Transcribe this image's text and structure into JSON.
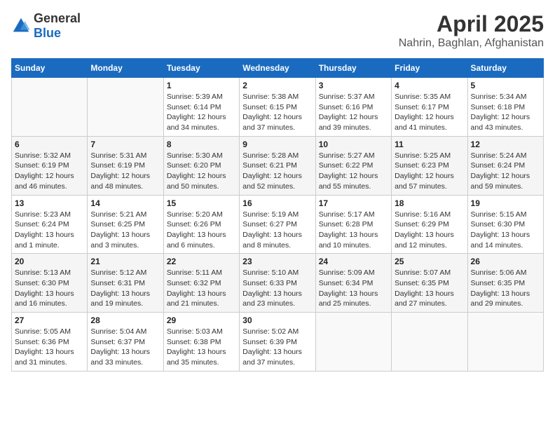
{
  "logo": {
    "general": "General",
    "blue": "Blue"
  },
  "title": "April 2025",
  "location": "Nahrin, Baghlan, Afghanistan",
  "weekdays": [
    "Sunday",
    "Monday",
    "Tuesday",
    "Wednesday",
    "Thursday",
    "Friday",
    "Saturday"
  ],
  "weeks": [
    [
      {
        "day": "",
        "sunrise": "",
        "sunset": "",
        "daylight": ""
      },
      {
        "day": "",
        "sunrise": "",
        "sunset": "",
        "daylight": ""
      },
      {
        "day": "1",
        "sunrise": "Sunrise: 5:39 AM",
        "sunset": "Sunset: 6:14 PM",
        "daylight": "Daylight: 12 hours and 34 minutes."
      },
      {
        "day": "2",
        "sunrise": "Sunrise: 5:38 AM",
        "sunset": "Sunset: 6:15 PM",
        "daylight": "Daylight: 12 hours and 37 minutes."
      },
      {
        "day": "3",
        "sunrise": "Sunrise: 5:37 AM",
        "sunset": "Sunset: 6:16 PM",
        "daylight": "Daylight: 12 hours and 39 minutes."
      },
      {
        "day": "4",
        "sunrise": "Sunrise: 5:35 AM",
        "sunset": "Sunset: 6:17 PM",
        "daylight": "Daylight: 12 hours and 41 minutes."
      },
      {
        "day": "5",
        "sunrise": "Sunrise: 5:34 AM",
        "sunset": "Sunset: 6:18 PM",
        "daylight": "Daylight: 12 hours and 43 minutes."
      }
    ],
    [
      {
        "day": "6",
        "sunrise": "Sunrise: 5:32 AM",
        "sunset": "Sunset: 6:19 PM",
        "daylight": "Daylight: 12 hours and 46 minutes."
      },
      {
        "day": "7",
        "sunrise": "Sunrise: 5:31 AM",
        "sunset": "Sunset: 6:19 PM",
        "daylight": "Daylight: 12 hours and 48 minutes."
      },
      {
        "day": "8",
        "sunrise": "Sunrise: 5:30 AM",
        "sunset": "Sunset: 6:20 PM",
        "daylight": "Daylight: 12 hours and 50 minutes."
      },
      {
        "day": "9",
        "sunrise": "Sunrise: 5:28 AM",
        "sunset": "Sunset: 6:21 PM",
        "daylight": "Daylight: 12 hours and 52 minutes."
      },
      {
        "day": "10",
        "sunrise": "Sunrise: 5:27 AM",
        "sunset": "Sunset: 6:22 PM",
        "daylight": "Daylight: 12 hours and 55 minutes."
      },
      {
        "day": "11",
        "sunrise": "Sunrise: 5:25 AM",
        "sunset": "Sunset: 6:23 PM",
        "daylight": "Daylight: 12 hours and 57 minutes."
      },
      {
        "day": "12",
        "sunrise": "Sunrise: 5:24 AM",
        "sunset": "Sunset: 6:24 PM",
        "daylight": "Daylight: 12 hours and 59 minutes."
      }
    ],
    [
      {
        "day": "13",
        "sunrise": "Sunrise: 5:23 AM",
        "sunset": "Sunset: 6:24 PM",
        "daylight": "Daylight: 13 hours and 1 minute."
      },
      {
        "day": "14",
        "sunrise": "Sunrise: 5:21 AM",
        "sunset": "Sunset: 6:25 PM",
        "daylight": "Daylight: 13 hours and 3 minutes."
      },
      {
        "day": "15",
        "sunrise": "Sunrise: 5:20 AM",
        "sunset": "Sunset: 6:26 PM",
        "daylight": "Daylight: 13 hours and 6 minutes."
      },
      {
        "day": "16",
        "sunrise": "Sunrise: 5:19 AM",
        "sunset": "Sunset: 6:27 PM",
        "daylight": "Daylight: 13 hours and 8 minutes."
      },
      {
        "day": "17",
        "sunrise": "Sunrise: 5:17 AM",
        "sunset": "Sunset: 6:28 PM",
        "daylight": "Daylight: 13 hours and 10 minutes."
      },
      {
        "day": "18",
        "sunrise": "Sunrise: 5:16 AM",
        "sunset": "Sunset: 6:29 PM",
        "daylight": "Daylight: 13 hours and 12 minutes."
      },
      {
        "day": "19",
        "sunrise": "Sunrise: 5:15 AM",
        "sunset": "Sunset: 6:30 PM",
        "daylight": "Daylight: 13 hours and 14 minutes."
      }
    ],
    [
      {
        "day": "20",
        "sunrise": "Sunrise: 5:13 AM",
        "sunset": "Sunset: 6:30 PM",
        "daylight": "Daylight: 13 hours and 16 minutes."
      },
      {
        "day": "21",
        "sunrise": "Sunrise: 5:12 AM",
        "sunset": "Sunset: 6:31 PM",
        "daylight": "Daylight: 13 hours and 19 minutes."
      },
      {
        "day": "22",
        "sunrise": "Sunrise: 5:11 AM",
        "sunset": "Sunset: 6:32 PM",
        "daylight": "Daylight: 13 hours and 21 minutes."
      },
      {
        "day": "23",
        "sunrise": "Sunrise: 5:10 AM",
        "sunset": "Sunset: 6:33 PM",
        "daylight": "Daylight: 13 hours and 23 minutes."
      },
      {
        "day": "24",
        "sunrise": "Sunrise: 5:09 AM",
        "sunset": "Sunset: 6:34 PM",
        "daylight": "Daylight: 13 hours and 25 minutes."
      },
      {
        "day": "25",
        "sunrise": "Sunrise: 5:07 AM",
        "sunset": "Sunset: 6:35 PM",
        "daylight": "Daylight: 13 hours and 27 minutes."
      },
      {
        "day": "26",
        "sunrise": "Sunrise: 5:06 AM",
        "sunset": "Sunset: 6:35 PM",
        "daylight": "Daylight: 13 hours and 29 minutes."
      }
    ],
    [
      {
        "day": "27",
        "sunrise": "Sunrise: 5:05 AM",
        "sunset": "Sunset: 6:36 PM",
        "daylight": "Daylight: 13 hours and 31 minutes."
      },
      {
        "day": "28",
        "sunrise": "Sunrise: 5:04 AM",
        "sunset": "Sunset: 6:37 PM",
        "daylight": "Daylight: 13 hours and 33 minutes."
      },
      {
        "day": "29",
        "sunrise": "Sunrise: 5:03 AM",
        "sunset": "Sunset: 6:38 PM",
        "daylight": "Daylight: 13 hours and 35 minutes."
      },
      {
        "day": "30",
        "sunrise": "Sunrise: 5:02 AM",
        "sunset": "Sunset: 6:39 PM",
        "daylight": "Daylight: 13 hours and 37 minutes."
      },
      {
        "day": "",
        "sunrise": "",
        "sunset": "",
        "daylight": ""
      },
      {
        "day": "",
        "sunrise": "",
        "sunset": "",
        "daylight": ""
      },
      {
        "day": "",
        "sunrise": "",
        "sunset": "",
        "daylight": ""
      }
    ]
  ]
}
